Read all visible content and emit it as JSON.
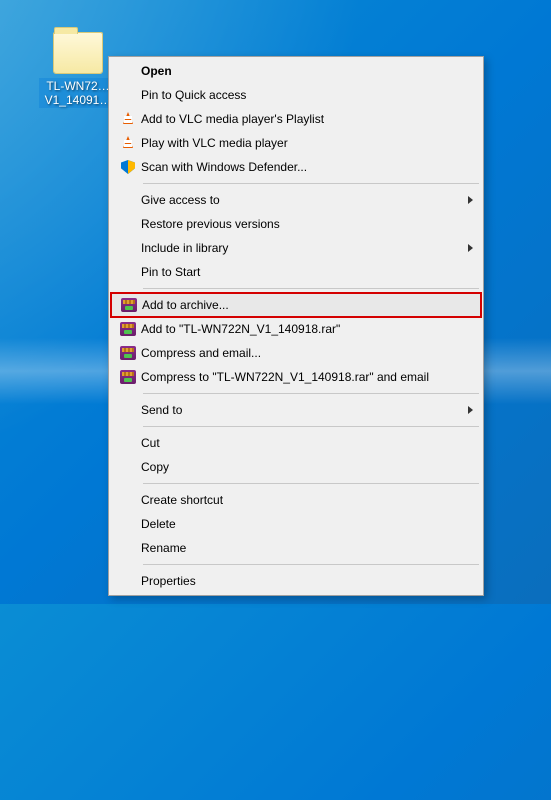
{
  "desktop": {
    "folder_label": "TL-WN72… V1_14091…"
  },
  "menu": {
    "open": "Open",
    "pin_quick": "Pin to Quick access",
    "vlc_playlist": "Add to VLC media player's Playlist",
    "vlc_play": "Play with VLC media player",
    "defender": "Scan with Windows Defender...",
    "give_access": "Give access to",
    "restore_prev": "Restore previous versions",
    "include_lib": "Include in library",
    "pin_start": "Pin to Start",
    "add_archive": "Add to archive...",
    "add_to_rar": "Add to \"TL-WN722N_V1_140918.rar\"",
    "compress_email": "Compress and email...",
    "compress_to_email": "Compress to \"TL-WN722N_V1_140918.rar\" and email",
    "send_to": "Send to",
    "cut": "Cut",
    "copy": "Copy",
    "create_shortcut": "Create shortcut",
    "delete": "Delete",
    "rename": "Rename",
    "properties": "Properties"
  }
}
